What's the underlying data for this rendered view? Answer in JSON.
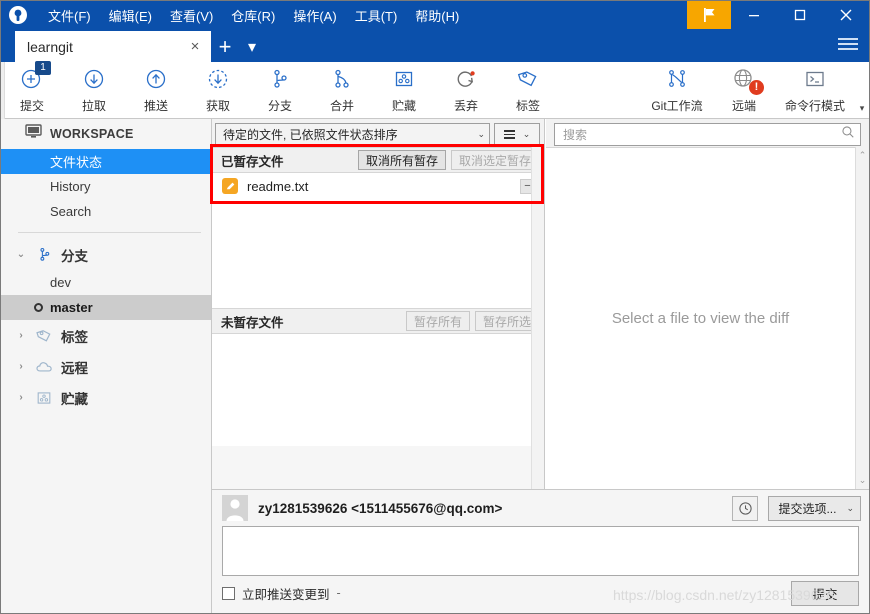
{
  "window": {
    "menus": [
      {
        "label": "文件(F)",
        "accel": "F"
      },
      {
        "label": "编辑(E)",
        "accel": "E"
      },
      {
        "label": "查看(V)",
        "accel": "V"
      },
      {
        "label": "仓库(R)",
        "accel": "R"
      },
      {
        "label": "操作(A)",
        "accel": "A"
      },
      {
        "label": "工具(T)",
        "accel": "T"
      },
      {
        "label": "帮助(H)",
        "accel": "H"
      }
    ],
    "flag_icon": "flag-icon",
    "minimize": "minimize-icon",
    "maximize": "maximize-icon",
    "close": "close-icon",
    "hamburger": "hamburger-icon",
    "titlebar_color": "#0b50ab",
    "flag_color": "#f7a600"
  },
  "tabs": {
    "items": [
      {
        "label": "learngit",
        "close": "×"
      }
    ],
    "add_label": "+",
    "caret_label": "▾"
  },
  "toolbar": {
    "buttons": [
      {
        "label": "提交",
        "icon": "commit-plus-icon",
        "badge": "1",
        "badge_type": "blue"
      },
      {
        "label": "拉取",
        "icon": "pull-down-arrow-icon",
        "badge": "",
        "badge_type": ""
      },
      {
        "label": "推送",
        "icon": "push-up-arrow-icon",
        "badge": "",
        "badge_type": ""
      },
      {
        "label": "获取",
        "icon": "fetch-dashed-arrow-icon",
        "badge": "",
        "badge_type": ""
      },
      {
        "label": "分支",
        "icon": "branch-icon",
        "badge": "",
        "badge_type": ""
      },
      {
        "label": "合并",
        "icon": "merge-icon",
        "badge": "",
        "badge_type": ""
      },
      {
        "label": "贮藏",
        "icon": "stash-icon",
        "badge": "",
        "badge_type": ""
      },
      {
        "label": "丢弃",
        "icon": "discard-refresh-icon",
        "badge": "",
        "badge_type": "dot"
      },
      {
        "label": "标签",
        "icon": "tag-icon",
        "badge": "",
        "badge_type": ""
      }
    ],
    "right_buttons": [
      {
        "label": "Git工作流",
        "icon": "gitflow-icon",
        "badge": "",
        "badge_type": ""
      },
      {
        "label": "远端",
        "icon": "globe-icon",
        "badge": "!",
        "badge_type": "red"
      },
      {
        "label": "命令行模式",
        "icon": "terminal-icon",
        "badge": "",
        "badge_type": ""
      }
    ],
    "scroll_caret": "▾"
  },
  "sidebar": {
    "workspace": {
      "label": "WORKSPACE",
      "icon": "monitor-icon"
    },
    "workspace_items": [
      {
        "label": "文件状态",
        "selected": true
      },
      {
        "label": "History",
        "selected": false
      },
      {
        "label": "Search",
        "selected": false
      }
    ],
    "groups": [
      {
        "label": "分支",
        "icon": "branch-icon",
        "chevron": "⌄",
        "expanded": true,
        "items": [
          {
            "label": "dev",
            "active": false
          },
          {
            "label": "master",
            "active": true
          }
        ]
      },
      {
        "label": "标签",
        "icon": "tag-icon",
        "chevron": "›",
        "expanded": false,
        "items": []
      },
      {
        "label": "远程",
        "icon": "cloud-icon",
        "chevron": "›",
        "expanded": false,
        "items": []
      },
      {
        "label": "贮藏",
        "icon": "stash-icon",
        "chevron": "›",
        "expanded": false,
        "items": []
      }
    ]
  },
  "file_panel": {
    "sort_select": {
      "label": "待定的文件, 已依照文件状态排序",
      "caret": "⌄"
    },
    "options_button": {
      "label": "",
      "caret": "⌄",
      "icon": "list-lines-icon"
    },
    "staged": {
      "title": "已暂存文件",
      "unstage_all_label": "取消所有暂存",
      "unstage_selected_label": "取消选定暂存",
      "unstage_selected_disabled": true,
      "files": [
        {
          "name": "readme.txt",
          "status_icon": "modified-pencil-icon",
          "status_color": "#f5a623",
          "action": "−"
        }
      ]
    },
    "unstaged": {
      "title": "未暂存文件",
      "stage_all_label": "暂存所有",
      "stage_selected_label": "暂存所选",
      "stage_all_disabled": true,
      "stage_selected_disabled": true,
      "files": []
    }
  },
  "diff_panel": {
    "search_placeholder": "搜索",
    "search_value": "",
    "search_icon": "search-icon",
    "empty_message": "Select a file to view the diff",
    "scroll_up": "⌃",
    "scroll_down": "⌄"
  },
  "commit": {
    "avatar": "user-avatar-icon",
    "author": "zy1281539626 <1511455676@qq.com>",
    "history_icon": "clock-icon",
    "options_label": "提交选项...",
    "options_caret": "⌄",
    "message_value": "",
    "message_placeholder": "",
    "push_checkbox_label": "立即推送变更到",
    "push_checkbox_checked": false,
    "push_target": "-",
    "commit_button_label": "提交"
  },
  "watermark": "https://blog.csdn.net/zy1281539626",
  "annotation": {
    "color": "#ff0000",
    "target": "已暂存文件 section"
  }
}
